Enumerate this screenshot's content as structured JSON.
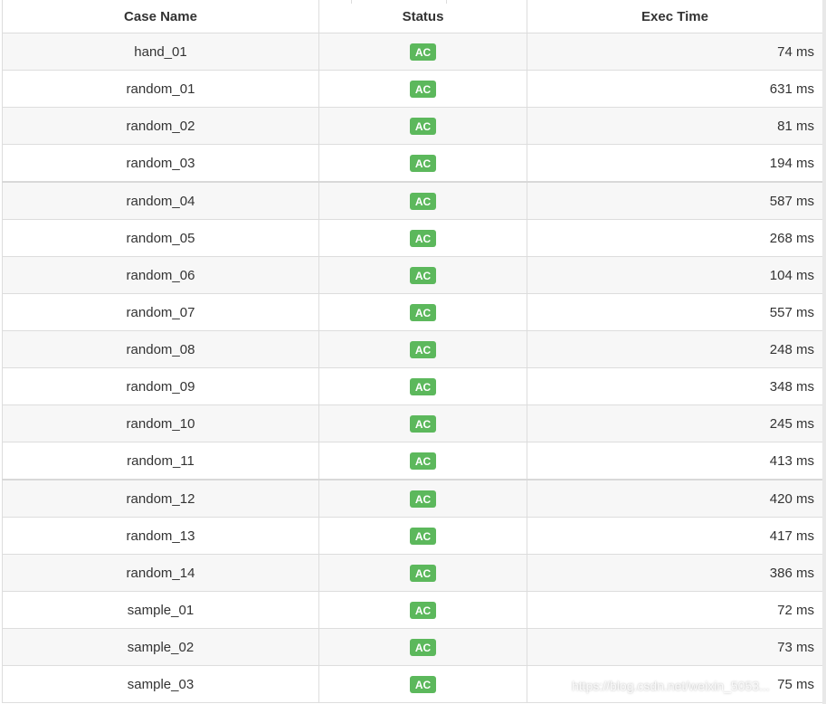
{
  "table": {
    "headers": [
      "Case Name",
      "Status",
      "Exec Time"
    ],
    "rows": [
      {
        "case": "hand_01",
        "status": "AC",
        "time": "74 ms"
      },
      {
        "case": "random_01",
        "status": "AC",
        "time": "631 ms"
      },
      {
        "case": "random_02",
        "status": "AC",
        "time": "81 ms"
      },
      {
        "case": "random_03",
        "status": "AC",
        "time": "194 ms"
      },
      {
        "case": "random_04",
        "status": "AC",
        "time": "587 ms"
      },
      {
        "case": "random_05",
        "status": "AC",
        "time": "268 ms"
      },
      {
        "case": "random_06",
        "status": "AC",
        "time": "104 ms"
      },
      {
        "case": "random_07",
        "status": "AC",
        "time": "557 ms"
      },
      {
        "case": "random_08",
        "status": "AC",
        "time": "248 ms"
      },
      {
        "case": "random_09",
        "status": "AC",
        "time": "348 ms"
      },
      {
        "case": "random_10",
        "status": "AC",
        "time": "245 ms"
      },
      {
        "case": "random_11",
        "status": "AC",
        "time": "413 ms"
      },
      {
        "case": "random_12",
        "status": "AC",
        "time": "420 ms"
      },
      {
        "case": "random_13",
        "status": "AC",
        "time": "417 ms"
      },
      {
        "case": "random_14",
        "status": "AC",
        "time": "386 ms"
      },
      {
        "case": "sample_01",
        "status": "AC",
        "time": "72 ms"
      },
      {
        "case": "sample_02",
        "status": "AC",
        "time": "73 ms"
      },
      {
        "case": "sample_03",
        "status": "AC",
        "time": "75 ms"
      }
    ]
  },
  "watermark": "https://blog.csdn.net/weixin_5053...",
  "colors": {
    "accepted_badge": "#5cb85c",
    "border": "#dddddd",
    "stripe": "#f7f7f7"
  }
}
